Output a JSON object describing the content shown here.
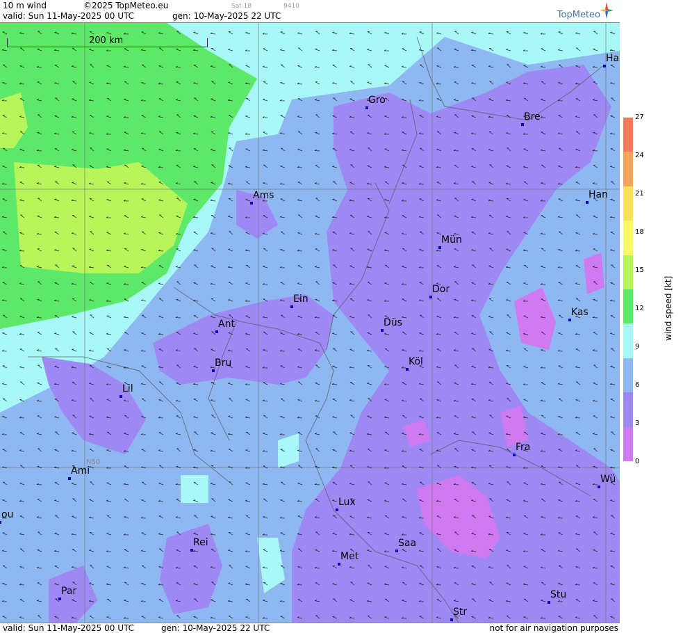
{
  "header": {
    "product": "10 m wind",
    "copyright": "©2025 TopMeteo.eu",
    "valid": "valid:  Sun  11-May-2025  00 UTC",
    "gen": "gen: 10-May-2025 22 UTC",
    "sat": "Sat 18",
    "code": "9410",
    "brand": "TopMeteo"
  },
  "footer": {
    "valid": "valid:  Sun  11-May-2025  00 UTC",
    "gen": "gen: 10-May-2025 22 UTC",
    "disclaimer": "not for air navigation purposes"
  },
  "map": {
    "scale_label": "200 km",
    "lat_label": "N50",
    "cities": [
      {
        "name": "Ha"
      },
      {
        "name": "Gro"
      },
      {
        "name": "Bre"
      },
      {
        "name": "Ams"
      },
      {
        "name": "Han"
      },
      {
        "name": "Mün"
      },
      {
        "name": "Ein"
      },
      {
        "name": "Dor"
      },
      {
        "name": "Kas"
      },
      {
        "name": "Ant"
      },
      {
        "name": "Düs"
      },
      {
        "name": "Bru"
      },
      {
        "name": "Köl"
      },
      {
        "name": "Lil"
      },
      {
        "name": "Fra"
      },
      {
        "name": "Ami"
      },
      {
        "name": "Wü"
      },
      {
        "name": "Lux"
      },
      {
        "name": "ou"
      },
      {
        "name": "Rei"
      },
      {
        "name": "Saa"
      },
      {
        "name": "Met"
      },
      {
        "name": "Par"
      },
      {
        "name": "Stu"
      },
      {
        "name": "Str"
      }
    ]
  },
  "legend": {
    "title": "wind speed [kt]",
    "ticks": [
      "27",
      "24",
      "21",
      "18",
      "15",
      "12",
      "9",
      "6",
      "3",
      "0"
    ],
    "colors": [
      "#f47a5c",
      "#f7a45a",
      "#fde15e",
      "#f9f96a",
      "#b8f55a",
      "#5ee86a",
      "#a8f8f8",
      "#8fb8f2",
      "#9d88f4",
      "#cf7af0"
    ]
  }
}
